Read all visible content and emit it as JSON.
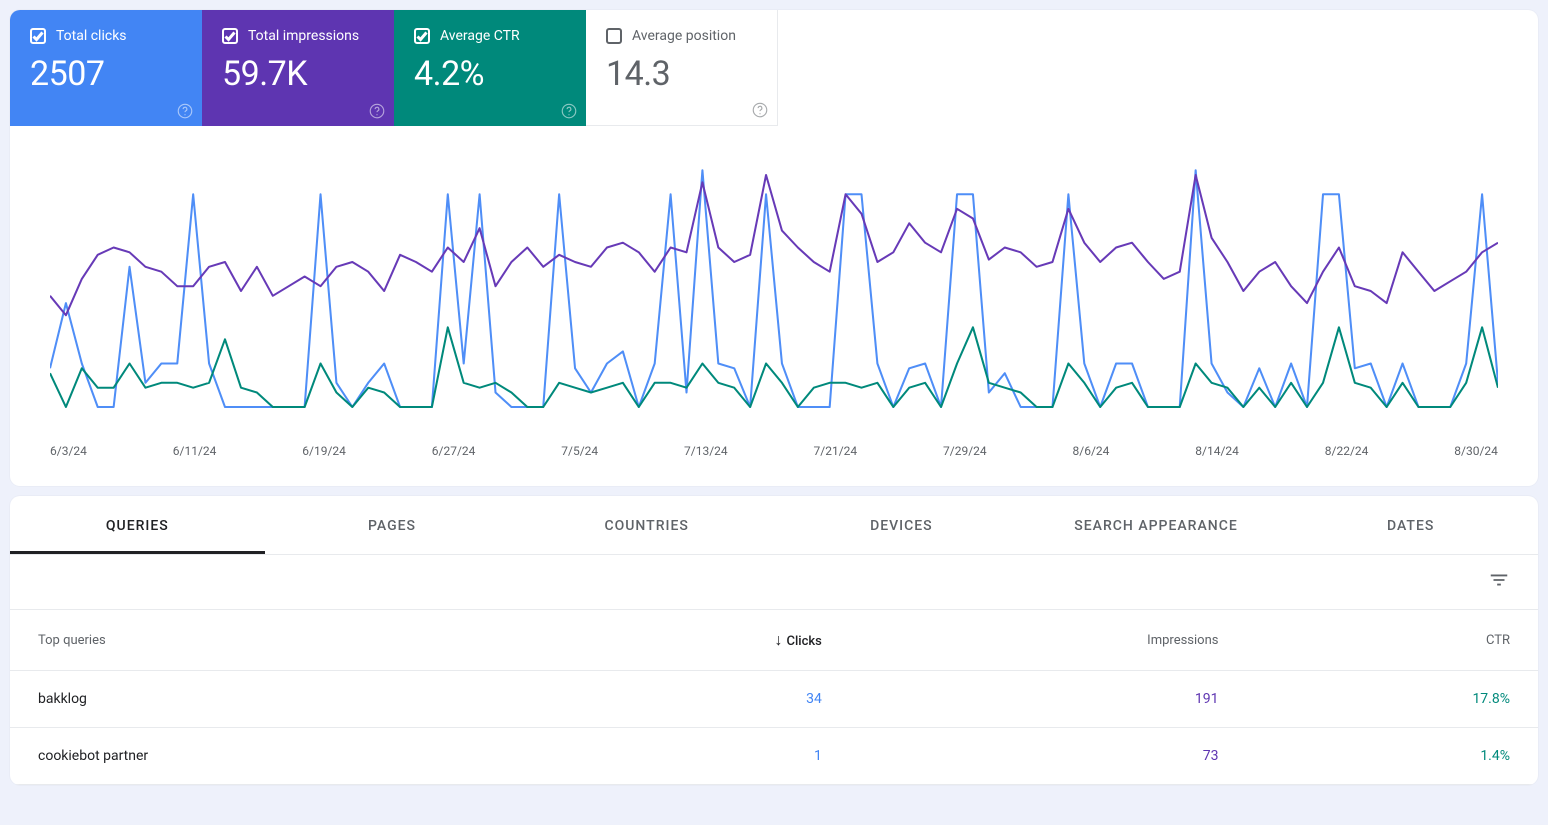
{
  "tiles": [
    {
      "label": "Total clicks",
      "value": "2507",
      "checked": true,
      "color": "blue"
    },
    {
      "label": "Total impressions",
      "value": "59.7K",
      "checked": true,
      "color": "purple"
    },
    {
      "label": "Average CTR",
      "value": "4.2%",
      "checked": true,
      "color": "teal"
    },
    {
      "label": "Average position",
      "value": "14.3",
      "checked": false,
      "color": "white"
    }
  ],
  "chart_data": {
    "type": "line",
    "x_ticks": [
      "6/3/24",
      "6/11/24",
      "6/19/24",
      "6/27/24",
      "7/5/24",
      "7/13/24",
      "7/21/24",
      "7/29/24",
      "8/6/24",
      "8/14/24",
      "8/22/24",
      "8/30/24"
    ],
    "n_points": 92,
    "series": [
      {
        "name": "Clicks",
        "color": "#4f8ef7",
        "values": [
          28,
          55,
          30,
          12,
          12,
          70,
          22,
          30,
          30,
          100,
          30,
          12,
          12,
          12,
          12,
          12,
          12,
          100,
          22,
          12,
          22,
          30,
          12,
          12,
          12,
          100,
          30,
          100,
          18,
          12,
          12,
          12,
          100,
          28,
          18,
          30,
          35,
          12,
          30,
          100,
          18,
          110,
          30,
          28,
          12,
          100,
          30,
          12,
          12,
          12,
          100,
          100,
          30,
          12,
          28,
          30,
          12,
          100,
          100,
          18,
          26,
          12,
          12,
          12,
          100,
          30,
          12,
          30,
          30,
          12,
          12,
          12,
          110,
          30,
          18,
          12,
          28,
          12,
          30,
          12,
          100,
          100,
          28,
          30,
          12,
          30,
          12,
          12,
          12,
          30,
          100,
          22
        ]
      },
      {
        "name": "Impressions",
        "color": "#673ab7",
        "values": [
          58,
          50,
          65,
          75,
          78,
          76,
          70,
          68,
          62,
          62,
          70,
          72,
          60,
          70,
          58,
          62,
          66,
          62,
          70,
          72,
          68,
          60,
          75,
          72,
          68,
          78,
          72,
          86,
          62,
          72,
          78,
          70,
          75,
          72,
          70,
          78,
          80,
          76,
          68,
          78,
          76,
          105,
          78,
          72,
          75,
          108,
          85,
          78,
          72,
          68,
          100,
          92,
          72,
          76,
          88,
          80,
          76,
          94,
          90,
          73,
          78,
          76,
          70,
          72,
          94,
          80,
          72,
          78,
          80,
          72,
          65,
          68,
          108,
          82,
          72,
          60,
          68,
          72,
          62,
          55,
          68,
          78,
          62,
          60,
          55,
          76,
          68,
          60,
          64,
          68,
          76,
          80
        ]
      },
      {
        "name": "CTR",
        "color": "#00897b",
        "values": [
          26,
          12,
          28,
          20,
          20,
          30,
          20,
          22,
          22,
          20,
          22,
          40,
          20,
          18,
          12,
          12,
          12,
          30,
          18,
          12,
          20,
          18,
          12,
          12,
          12,
          45,
          22,
          20,
          22,
          18,
          12,
          12,
          22,
          20,
          18,
          20,
          22,
          12,
          22,
          22,
          20,
          30,
          22,
          20,
          12,
          30,
          22,
          12,
          20,
          22,
          22,
          20,
          22,
          12,
          20,
          22,
          12,
          30,
          45,
          22,
          20,
          18,
          12,
          12,
          30,
          22,
          12,
          20,
          22,
          12,
          12,
          12,
          30,
          22,
          20,
          12,
          20,
          12,
          22,
          12,
          22,
          45,
          22,
          20,
          12,
          22,
          12,
          12,
          12,
          22,
          45,
          20
        ]
      }
    ],
    "y_range": [
      0,
      120
    ]
  },
  "tabs": [
    "QUERIES",
    "PAGES",
    "COUNTRIES",
    "DEVICES",
    "SEARCH APPEARANCE",
    "DATES"
  ],
  "active_tab": 0,
  "table": {
    "columns": [
      "Top queries",
      "Clicks",
      "Impressions",
      "CTR"
    ],
    "sort_column": 1,
    "rows": [
      {
        "query": "bakklog",
        "clicks": "34",
        "impressions": "191",
        "ctr": "17.8%"
      },
      {
        "query": "cookiebot partner",
        "clicks": "1",
        "impressions": "73",
        "ctr": "1.4%"
      }
    ]
  }
}
